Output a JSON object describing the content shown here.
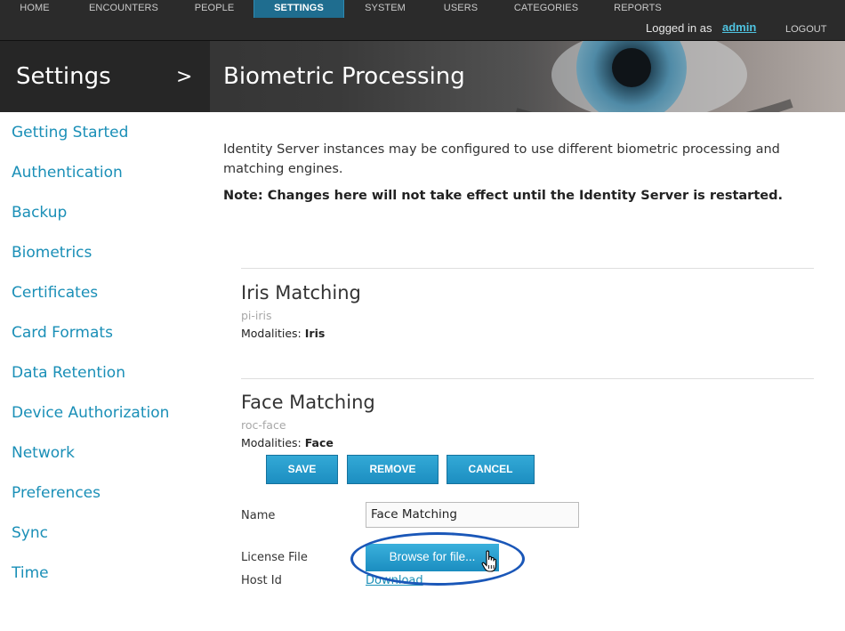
{
  "nav": {
    "items": [
      {
        "label": "HOME"
      },
      {
        "label": "ENCOUNTERS"
      },
      {
        "label": "PEOPLE"
      },
      {
        "label": "SETTINGS"
      },
      {
        "label": "SYSTEM"
      },
      {
        "label": "USERS"
      },
      {
        "label": "CATEGORIES"
      },
      {
        "label": "REPORTS"
      }
    ],
    "active": "SETTINGS",
    "login_prefix": "Logged in as",
    "login_user": "admin",
    "logout": "LOGOUT"
  },
  "header": {
    "section": "Settings",
    "arrow": ">",
    "title": "Biometric Processing"
  },
  "sidebar": {
    "items": [
      {
        "label": "Getting Started"
      },
      {
        "label": "Authentication"
      },
      {
        "label": "Backup"
      },
      {
        "label": "Biometrics"
      },
      {
        "label": "Certificates"
      },
      {
        "label": "Card Formats"
      },
      {
        "label": "Data Retention"
      },
      {
        "label": "Device Authorization"
      },
      {
        "label": "Network"
      },
      {
        "label": "Preferences"
      },
      {
        "label": "Sync"
      },
      {
        "label": "Time"
      }
    ]
  },
  "main": {
    "intro": "Identity Server instances may be configured to use different biometric processing and matching engines.",
    "note": "Note: Changes here will not take effect until the Identity Server is restarted.",
    "engines": [
      {
        "title": "Iris Matching",
        "id": "pi-iris",
        "modalities_label": "Modalities:",
        "modalities": "Iris"
      },
      {
        "title": "Face Matching",
        "id": "roc-face",
        "modalities_label": "Modalities:",
        "modalities": "Face"
      }
    ],
    "buttons": {
      "save": "SAVE",
      "remove": "REMOVE",
      "cancel": "CANCEL"
    },
    "form": {
      "name_label": "Name",
      "name_value": "Face Matching",
      "license_label": "License File",
      "browse": "Browse for file...",
      "hostid_label": "Host Id",
      "download": "Download"
    }
  },
  "colors": {
    "accent": "#1a8fb7",
    "button": "#1c8ec1",
    "topbar": "#2b2b2b",
    "active_nav": "#1f6d8f",
    "highlight": "#1a57b8"
  }
}
